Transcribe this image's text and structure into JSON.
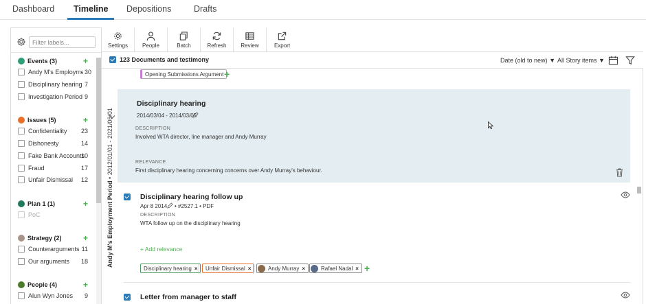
{
  "nav": {
    "tabs": [
      {
        "label": "Dashboard"
      },
      {
        "label": "Timeline"
      },
      {
        "label": "Depositions"
      },
      {
        "label": "Drafts"
      }
    ],
    "active": "Timeline"
  },
  "sidebar": {
    "filter_placeholder": "Filter labels...",
    "groups": [
      {
        "name": "Events (3)",
        "color": "#2e9e74",
        "items": [
          {
            "label": "Andy M's Employme...",
            "count": "30"
          },
          {
            "label": "Disciplinary hearing",
            "count": "7"
          },
          {
            "label": "Investigation Period",
            "count": "9"
          }
        ]
      },
      {
        "name": "Issues (5)",
        "color": "#e8702a",
        "items": [
          {
            "label": "Confidentiality",
            "count": "23"
          },
          {
            "label": "Dishonesty",
            "count": "14"
          },
          {
            "label": "Fake Bank Accounts",
            "count": "10"
          },
          {
            "label": "Fraud",
            "count": "17"
          },
          {
            "label": "Unfair Dismissal",
            "count": "12"
          }
        ]
      },
      {
        "name": "Plan 1 (1)",
        "color": "#1f7a5a",
        "items": [
          {
            "label": "PoC",
            "count": ""
          }
        ]
      },
      {
        "name": "Strategy (2)",
        "color": "#a89488",
        "items": [
          {
            "label": "Counterarguments",
            "count": "11"
          },
          {
            "label": "Our arguments",
            "count": "18"
          }
        ]
      },
      {
        "name": "People (4)",
        "color": "#4a7a2a",
        "items": [
          {
            "label": "Alun Wyn Jones",
            "count": "9"
          }
        ]
      }
    ]
  },
  "toolbar": {
    "settings": "Settings",
    "people": "People",
    "batch": "Batch",
    "refresh": "Refresh",
    "review": "Review",
    "export": "Export"
  },
  "header": {
    "title": "123 Documents and testimony",
    "sort": "Date (old to new)",
    "story": "All Story items"
  },
  "period": {
    "label": "Andy M's Employment Period",
    "range": "2012/01/01 - 2021/06/01"
  },
  "top_chip": "Opening Submissions Argument",
  "card1": {
    "title": "Disciplinary hearing",
    "dates": "2014/03/04 - 2014/03/05",
    "desc_caption": "DESCRIPTION",
    "desc": "Involved WTA director, line manager and Andy Murray",
    "rel_caption": "RELEVANCE",
    "rel": "First disciplinary hearing concerning concerns over Andy Murray's behaviour."
  },
  "card2": {
    "title": "Disciplinary hearing follow up",
    "date": "Apr 8 2014",
    "meta": "• #2527.1 • PDF",
    "desc_caption": "DESCRIPTION",
    "desc": "WTA follow up on the disciplinary hearing",
    "add_relevance": "+ Add relevance",
    "chips": [
      "Disciplinary hearing",
      "Unfair Dismissal",
      "Andy Murray",
      "Rafael Nadal"
    ]
  },
  "card3": {
    "title": "Letter from manager to staff"
  },
  "colors": {
    "accent": "#2a7ab8",
    "green": "#4caf50",
    "highlight": "#e4eef2"
  }
}
